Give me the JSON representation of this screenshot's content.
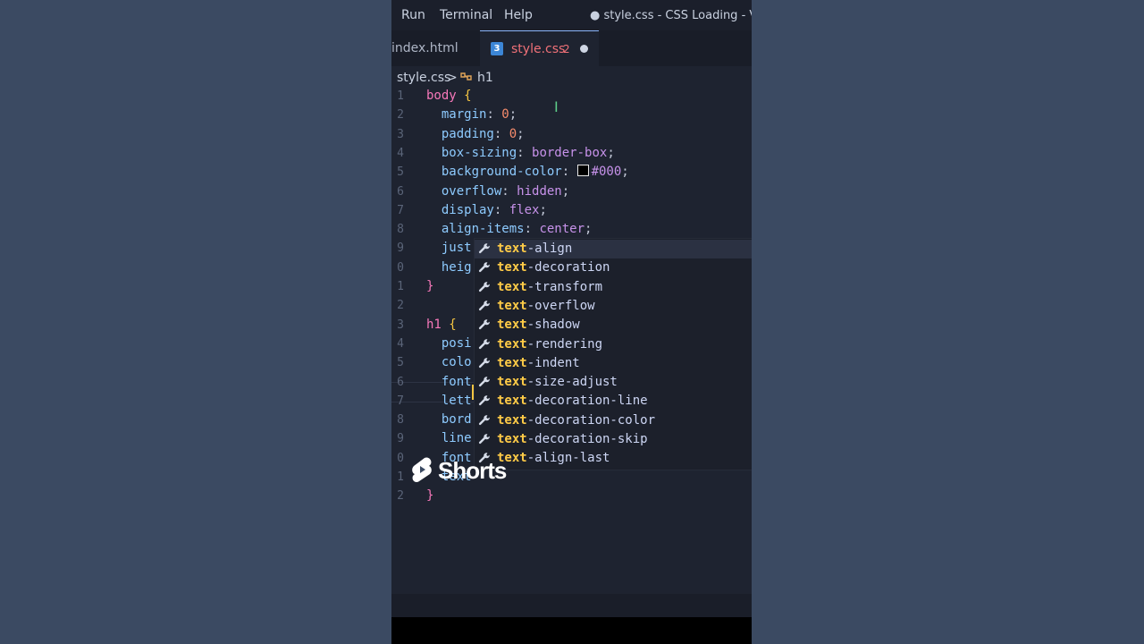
{
  "menu": [
    "Run",
    "Terminal",
    "Help"
  ],
  "window_title": "● style.css - CSS Loading - Visu",
  "tabs": [
    {
      "label": "index.html"
    },
    {
      "label": "style.css",
      "problems": "2",
      "icon": "css3-icon"
    }
  ],
  "breadcrumb": {
    "file": "style.css",
    "separator": ">",
    "symbol": "h1"
  },
  "code_lines": [
    {
      "n": "1",
      "t": "body {"
    },
    {
      "n": "2",
      "t": "  margin: 0;"
    },
    {
      "n": "3",
      "t": "  padding: 0;"
    },
    {
      "n": "4",
      "t": "  box-sizing: border-box;"
    },
    {
      "n": "5",
      "t": "  background-color: #000;"
    },
    {
      "n": "6",
      "t": "  overflow: hidden;"
    },
    {
      "n": "7",
      "t": "  display: flex;"
    },
    {
      "n": "8",
      "t": "  align-items: center;"
    },
    {
      "n": "9",
      "t": "  just"
    },
    {
      "n": "0",
      "t": "  heig"
    },
    {
      "n": "1",
      "t": "}"
    },
    {
      "n": "2",
      "t": ""
    },
    {
      "n": "3",
      "t": "h1 {"
    },
    {
      "n": "4",
      "t": "  posi"
    },
    {
      "n": "5",
      "t": "  colo"
    },
    {
      "n": "6",
      "t": "  font"
    },
    {
      "n": "7",
      "t": "  lett"
    },
    {
      "n": "8",
      "t": "  bord"
    },
    {
      "n": "9",
      "t": "  line"
    },
    {
      "n": "0",
      "t": "  font"
    },
    {
      "n": "1",
      "t": "  text"
    },
    {
      "n": "2",
      "t": "}"
    }
  ],
  "suggestions": [
    {
      "match": "text",
      "rest": "-align"
    },
    {
      "match": "text",
      "rest": "-decoration"
    },
    {
      "match": "text",
      "rest": "-transform"
    },
    {
      "match": "text",
      "rest": "-overflow"
    },
    {
      "match": "text",
      "rest": "-shadow"
    },
    {
      "match": "text",
      "rest": "-rendering"
    },
    {
      "match": "text",
      "rest": "-indent"
    },
    {
      "match": "text",
      "rest": "-size-adjust"
    },
    {
      "match": "text",
      "rest": "-decoration-line"
    },
    {
      "match": "text",
      "rest": "-decoration-color"
    },
    {
      "match": "text",
      "rest": "-decoration-skip"
    },
    {
      "match": "text",
      "rest": "-align-last"
    }
  ],
  "overlay": {
    "label": "Shorts",
    "icon": "youtube-shorts-icon"
  },
  "colors": {
    "selector": "#f778ba",
    "property": "#8ecbff",
    "value": "#c792ea",
    "number": "#f78c6c",
    "match": "#ffcb47",
    "error": "#f07178"
  }
}
